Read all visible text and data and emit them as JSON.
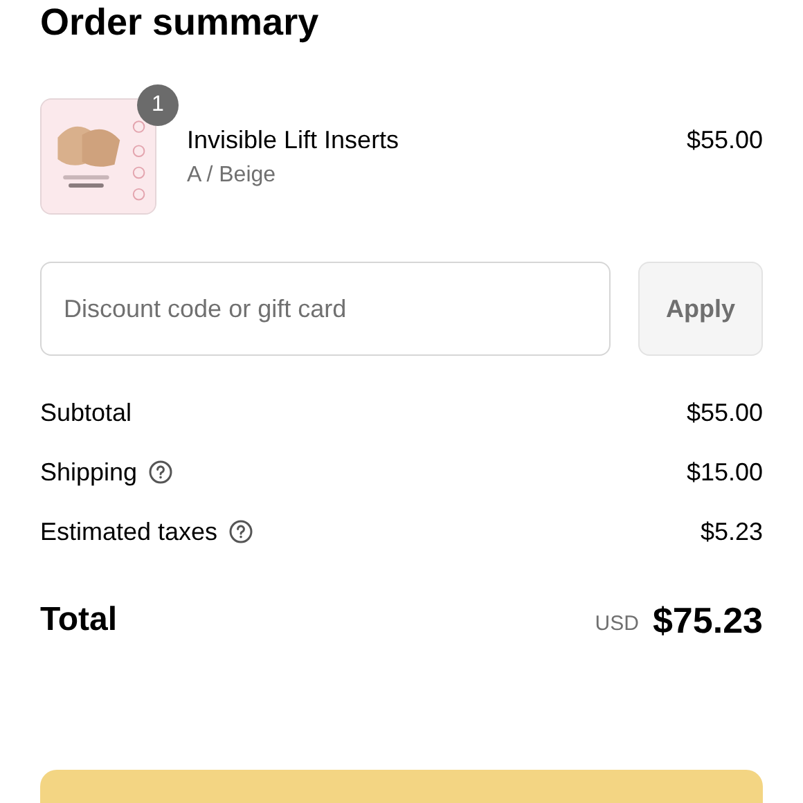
{
  "title": "Order summary",
  "items": [
    {
      "kind": "picture",
      "quantity": "1",
      "name": "Invisible Lift Inserts",
      "variant": "A / Beige",
      "price": "$55.00"
    }
  ],
  "discount": {
    "placeholder": "Discount code or gift card",
    "button": "Apply"
  },
  "lines": [
    {
      "label": "Subtotal",
      "help": false,
      "value": "$55.00"
    },
    {
      "label": "Shipping",
      "help": true,
      "value": "$15.00"
    },
    {
      "label": "Estimated taxes",
      "help": true,
      "value": "$5.23"
    }
  ],
  "total": {
    "label": "Total",
    "currency": "USD",
    "value": "$75.23"
  }
}
